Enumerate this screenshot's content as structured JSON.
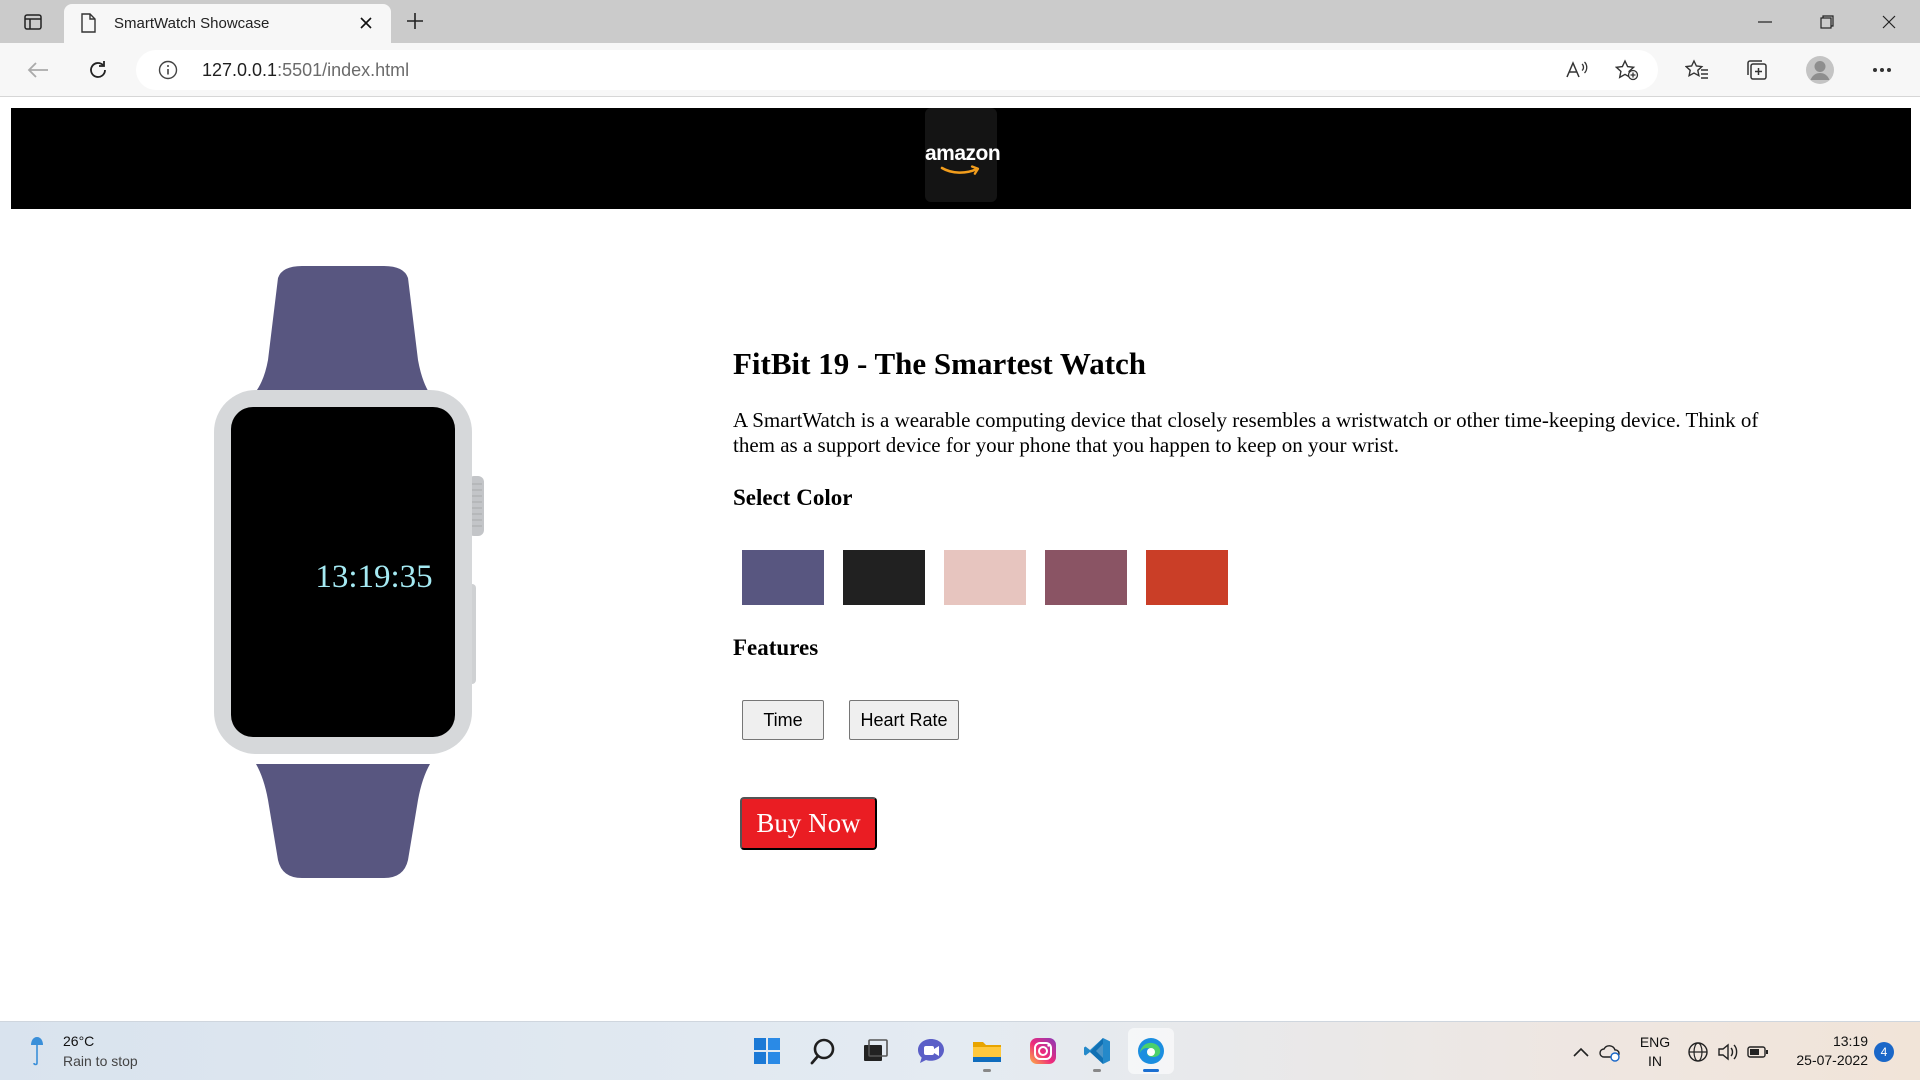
{
  "browser": {
    "tab_title": "SmartWatch Showcase",
    "url_host": "127.0.0.1",
    "url_path": ":5501/index.html"
  },
  "site": {
    "logo_text": "amazon"
  },
  "watch": {
    "time_display": "13:19:35",
    "band_color": "#585680"
  },
  "product": {
    "title": "FitBit 19 - The Smartest Watch",
    "description": "A SmartWatch is a wearable computing device that closely resembles a wristwatch or other time-keeping device. Think of them as a support device for your phone that you happen to keep on your wrist.",
    "color_heading": "Select Color",
    "colors": [
      "#585680",
      "#212121",
      "#e7c5bf",
      "#8a5464",
      "#ca3e27"
    ],
    "features_heading": "Features",
    "features": [
      "Time",
      "Heart Rate"
    ],
    "buy_label": "Buy Now",
    "buy_color": "#ea1d23"
  },
  "taskbar": {
    "weather_temp": "26°C",
    "weather_condition": "Rain to stop",
    "lang_line1": "ENG",
    "lang_line2": "IN",
    "time": "13:19",
    "date": "25-07-2022",
    "notification_count": "4",
    "apps": [
      "start-icon",
      "search-icon",
      "task-view-icon",
      "chat-icon",
      "file-explorer-icon",
      "instagram-icon",
      "vscode-icon",
      "edge-icon"
    ]
  }
}
